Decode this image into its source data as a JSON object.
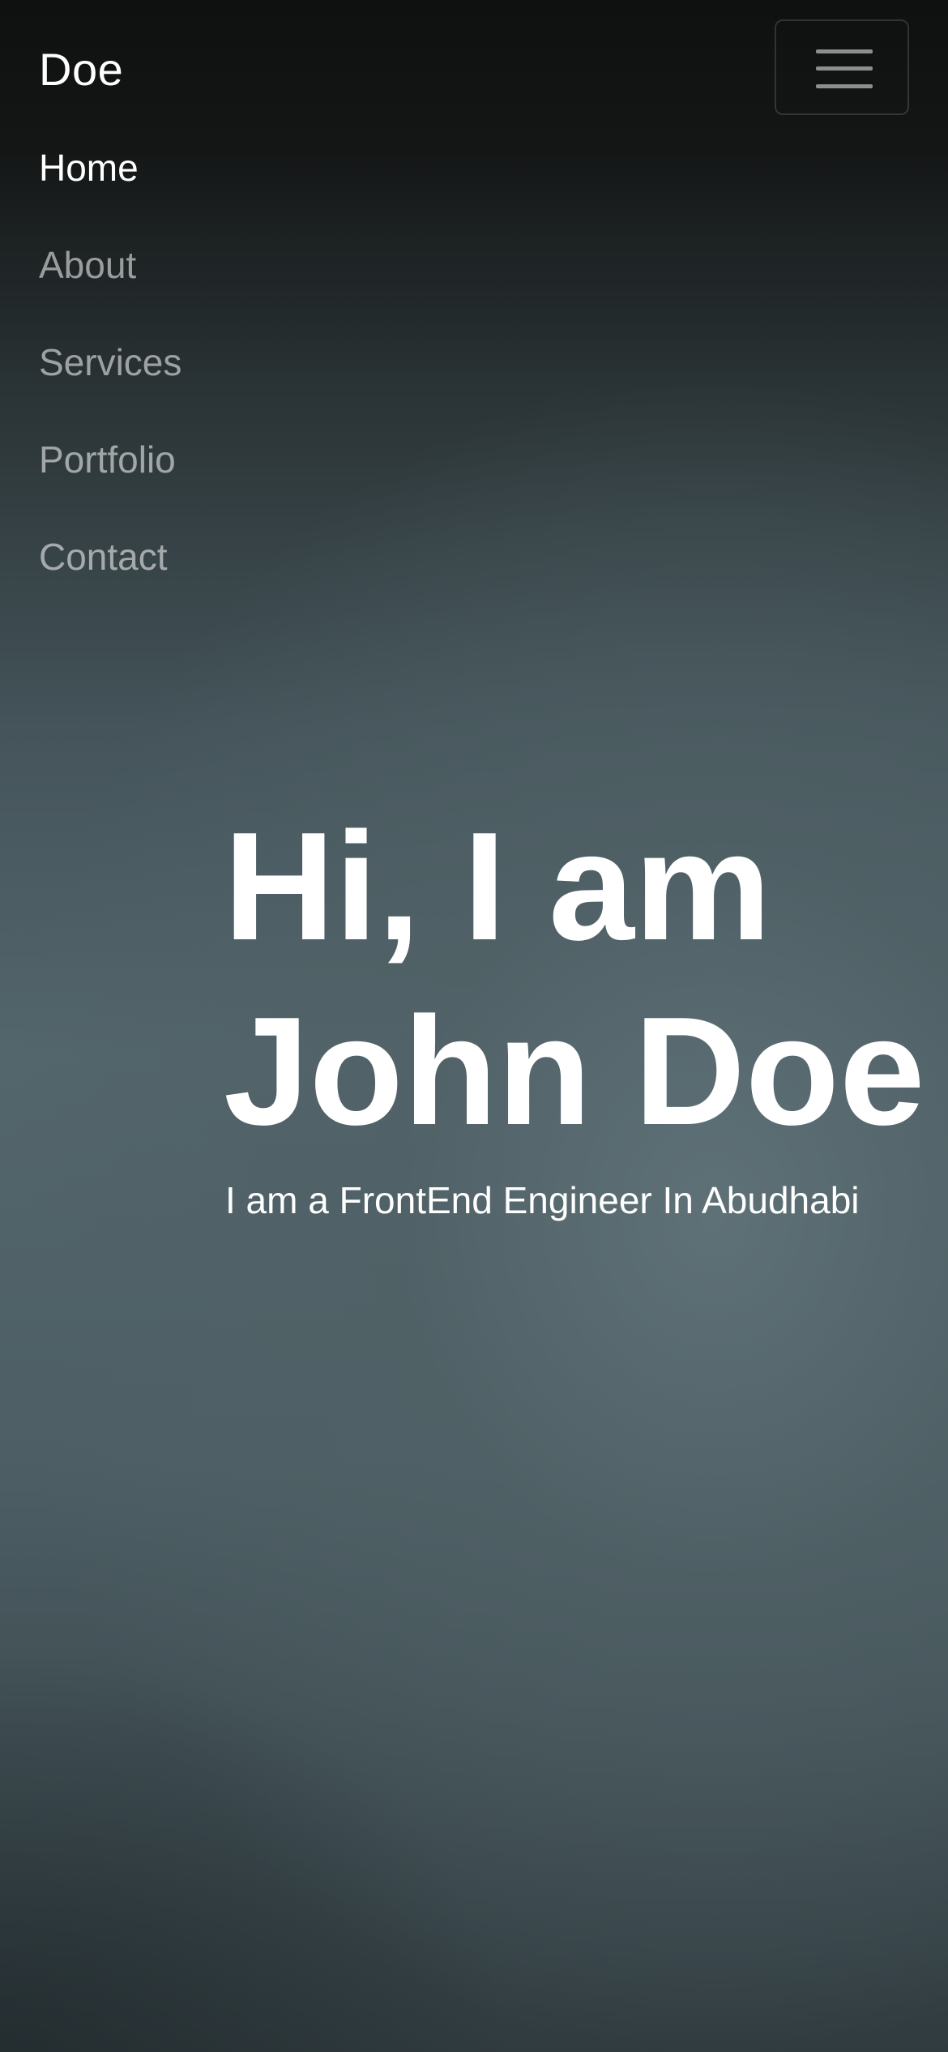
{
  "navbar": {
    "brand": "Doe",
    "toggler_icon": "hamburger-menu-icon",
    "items": [
      {
        "label": "Home",
        "active": true
      },
      {
        "label": "About",
        "active": false
      },
      {
        "label": "Services",
        "active": false
      },
      {
        "label": "Portfolio",
        "active": false
      },
      {
        "label": "Contact",
        "active": false
      }
    ]
  },
  "hero": {
    "title_line1": "Hi, I am",
    "title_line2": "John Doe",
    "subtitle": "I am a FrontEnd Engineer In Abudhabi"
  },
  "colors": {
    "text": "#ffffff",
    "nav_inactive": "rgba(255,255,255,0.55)",
    "background_dark": "#0f1010",
    "background_slate": "#53666c"
  }
}
